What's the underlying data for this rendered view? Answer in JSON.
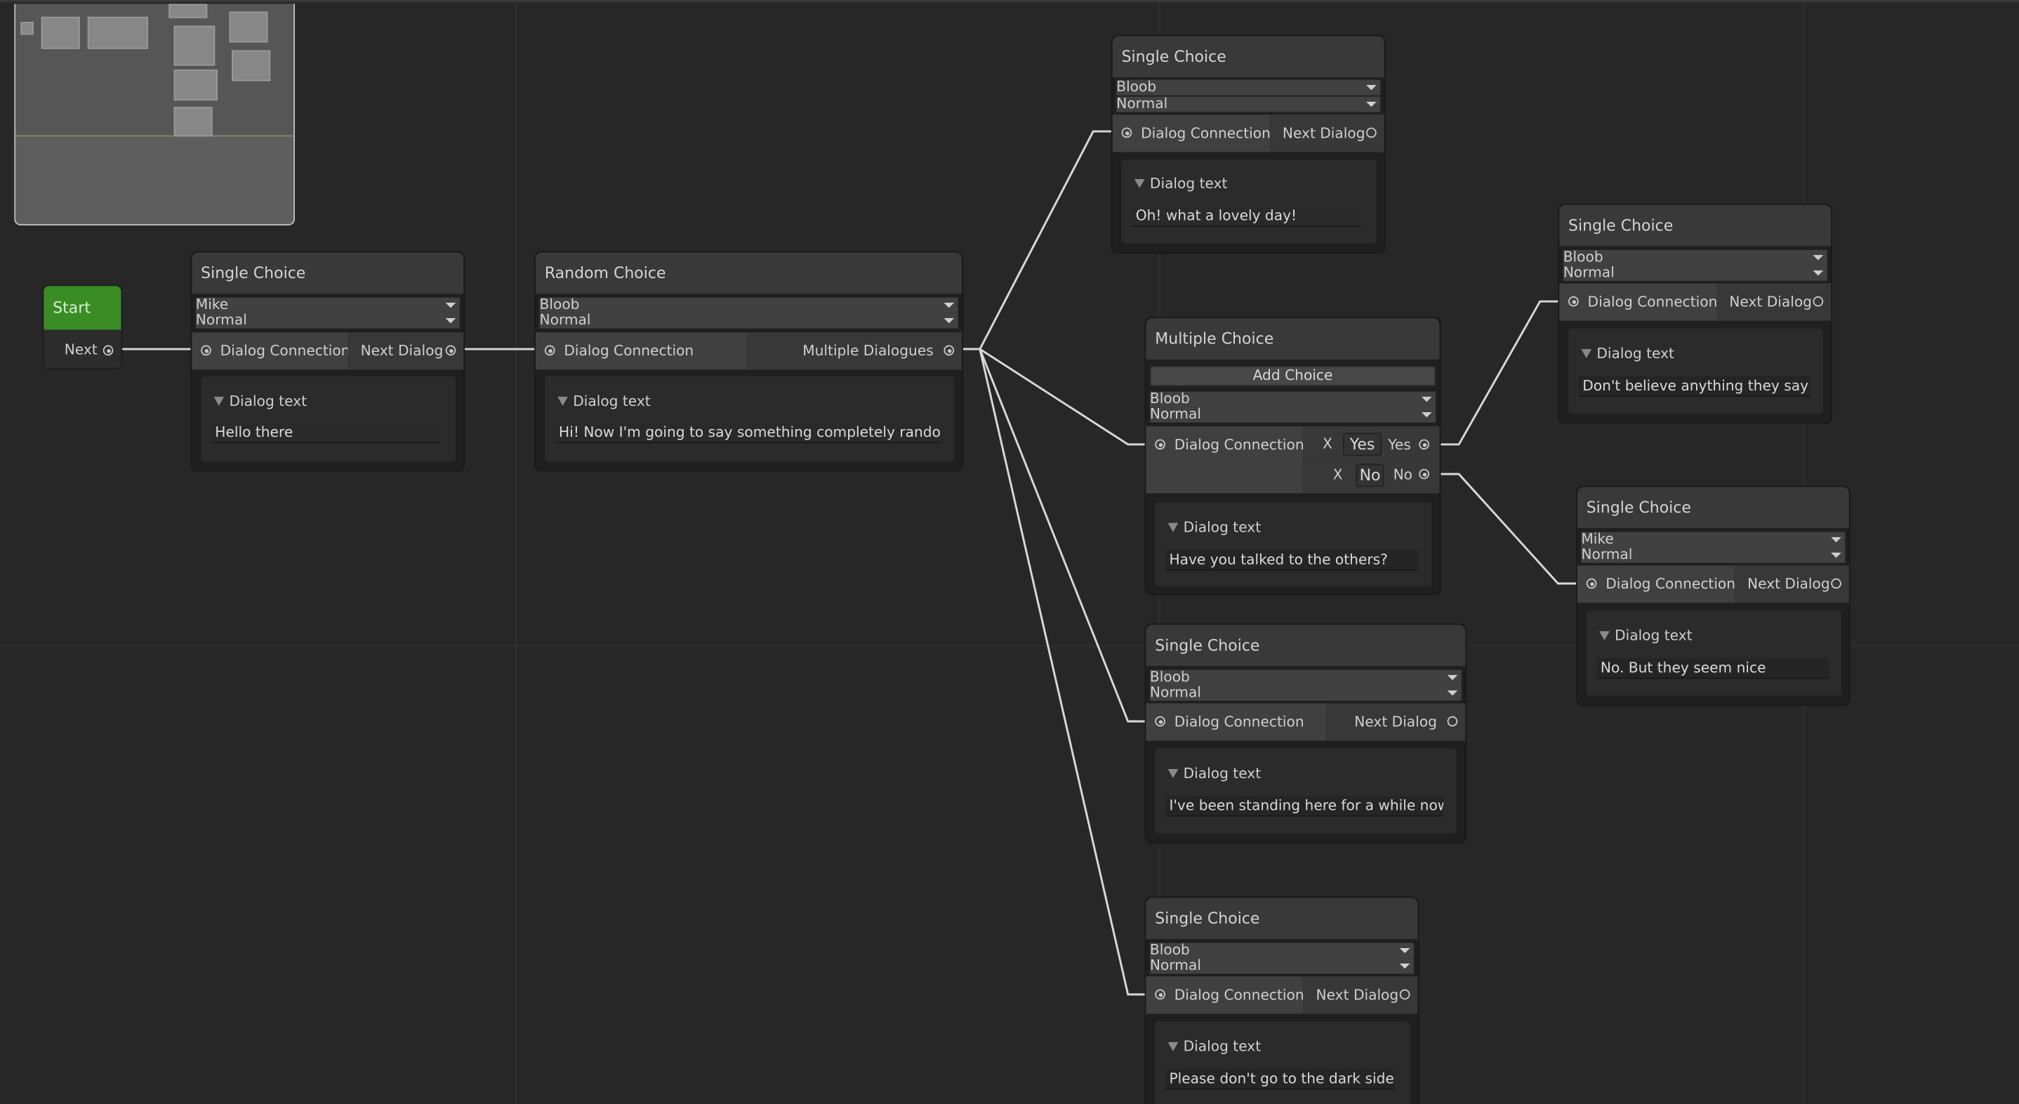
{
  "start_node": {
    "title": "Start",
    "port_label": "Next"
  },
  "common": {
    "input_port": "Dialog Connection",
    "output_port": "Next Dialog",
    "fold_label": "Dialog text",
    "mood": "Normal"
  },
  "nodes": {
    "n1": {
      "title": "Single Choice",
      "speaker": "Mike",
      "mood": "Normal",
      "text": "Hello there"
    },
    "n2": {
      "title": "Random Choice",
      "speaker": "Bloob",
      "mood": "Normal",
      "output": "Multiple Dialogues",
      "text": "Hi! Now I'm going to say something completely random:"
    },
    "n3": {
      "title": "Single Choice",
      "speaker": "Bloob",
      "mood": "Normal",
      "text": "Oh! what a lovely day!"
    },
    "n4": {
      "title": "Multiple Choice",
      "add_choice": "Add Choice",
      "speaker": "Bloob",
      "mood": "Normal",
      "choices": [
        {
          "remove": "X",
          "value": "Yes",
          "port": "Yes"
        },
        {
          "remove": "X",
          "value": "No",
          "port": "No"
        }
      ],
      "text": "Have you talked to the others?"
    },
    "n5": {
      "title": "Single Choice",
      "speaker": "Bloob",
      "mood": "Normal",
      "text": "I've been standing here for a while now."
    },
    "n6": {
      "title": "Single Choice",
      "speaker": "Bloob",
      "mood": "Normal",
      "text": "Please don't go to the dark side"
    },
    "n7": {
      "title": "Single Choice",
      "speaker": "Bloob",
      "mood": "Normal",
      "text": "Don't believe anything they say!"
    },
    "n8": {
      "title": "Single Choice",
      "speaker": "Mike",
      "mood": "Normal",
      "text": "No. But they seem nice"
    }
  }
}
